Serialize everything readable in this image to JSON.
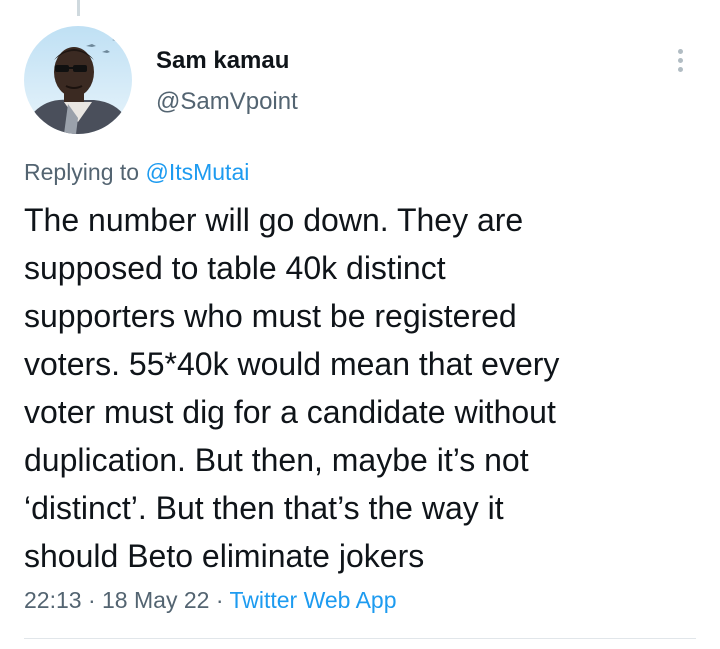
{
  "author": {
    "display_name": "Sam kamau",
    "handle": "@SamVpoint",
    "avatar_icon": "profile-photo"
  },
  "reply": {
    "prefix": "Replying to",
    "mention": "@ItsMutai"
  },
  "tweet": {
    "lines": [
      "The number will go down. They are",
      "supposed to table 40k distinct",
      "supporters who must be registered",
      "voters. 55*40k would mean that every",
      "voter must dig for a candidate without",
      "duplication. But then, maybe it’s not",
      "‘distinct’. But then that’s the way it",
      "should Beto eliminate jokers"
    ]
  },
  "meta": {
    "time": "22:13",
    "separator": "·",
    "date": "18 May 22",
    "source": "Twitter Web App"
  },
  "colors": {
    "link": "#1d9bf0",
    "secondary_text": "#536471",
    "primary_text": "#0f1419"
  },
  "icons": {
    "more": "more-options-icon"
  }
}
